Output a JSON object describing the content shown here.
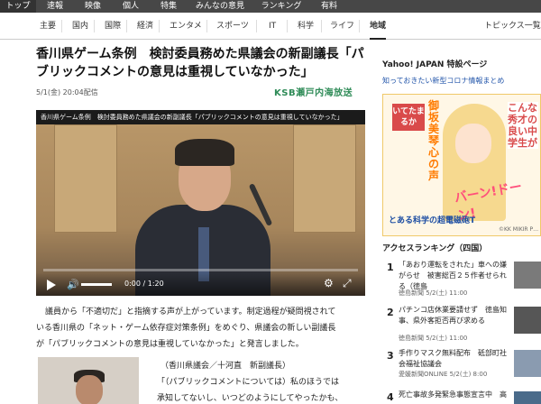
{
  "topnav": {
    "tabs": [
      "トップ",
      "速報",
      "映像",
      "個人",
      "特集",
      "みんなの意見",
      "ランキング",
      "有料"
    ],
    "active_index": 0
  },
  "catnav": {
    "items": [
      "主要",
      "国内",
      "国際",
      "経済",
      "エンタメ",
      "スポーツ",
      "IT",
      "科学",
      "ライフ",
      "地域"
    ],
    "active_index": 9,
    "topics_link": "トピックス一覧"
  },
  "article": {
    "title": "香川県ゲーム条例　検討委員務めた県議会の新副議長「パブリックコメントの意見は重視していなかった」",
    "date": "5/1(金) 20:04配信",
    "source": "KSB瀬戸内海放送",
    "video": {
      "overlay_title": "香川県ゲーム条例　検討委員務めた県議会の新副議長「パブリックコメントの意見は重視していなかった」",
      "time": "0:00 / 1:20"
    },
    "body_lines": [
      "議員から「不適切だ」と指摘する声が上がっています。制定過程が疑問視されて",
      "いる香川県の「ネット・ゲーム依存症対策条例」をめぐり、県議会の新しい副議長",
      "が「パブリックコメントの意見は重視していなかった」と発言しました。"
    ],
    "quote_lines": [
      "（香川県議会／十河直　新副議長）",
      "「（パブリックコメントについては）私のほうでは",
      "承知してないし、いつどのようにしてやったかも、"
    ]
  },
  "sidebar": {
    "yahoo_heading": "Yahoo! JAPAN 特設ページ",
    "yahoo_sub": "知っておきたい新型コロナ情報まとめ",
    "ad": {
      "text1": "いてたまるか",
      "text2": "こんな秀才の良い中学生が",
      "text3": "御坂美琴心の声",
      "text4": "バーン!ドーン!",
      "text5": "とある科学の超電磁砲T",
      "text6": "©KK MIKIR P…"
    },
    "ranking": {
      "title": "アクセスランキング（四国）",
      "items": [
        {
          "num": "1",
          "text": "「あおり運転をされた」車への嫌がらせ　被害総百２５作者せられる（徳島",
          "meta": "徳島新聞 5/2(土) 11:00"
        },
        {
          "num": "2",
          "text": "パチンコ店休業要請せず　徳島知事、県外客拒否再び求める",
          "meta": "徳島新聞 5/2(土) 11:00"
        },
        {
          "num": "3",
          "text": "手作りマスク無料配布　砥部町社会福祉協議会",
          "meta": "愛媛新聞ONLINE 5/2(土) 8:00"
        },
        {
          "num": "4",
          "text": "死亡事故多発緊急事態宣言中　高",
          "meta": ""
        }
      ]
    }
  }
}
